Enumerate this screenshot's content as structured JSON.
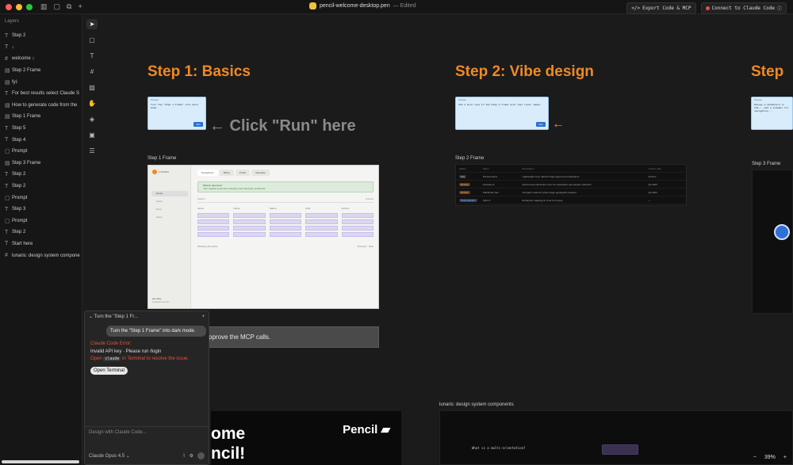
{
  "titlebar": {
    "filename": "pencil-welcome-desktop.pen",
    "status": "— Edited",
    "export_label": "Export Code & MCP",
    "connect_label": "Connect to Claude Code"
  },
  "layers": {
    "title": "Layers",
    "items": [
      {
        "icon": "T",
        "label": "Step 2"
      },
      {
        "icon": "T",
        "label": "↓"
      },
      {
        "icon": "#",
        "label": "welcome ↓"
      },
      {
        "icon": "▤",
        "label": "Step 2 Frame"
      },
      {
        "icon": "▤",
        "label": "fyi:"
      },
      {
        "icon": "T",
        "label": "For best results select Claude S"
      },
      {
        "icon": "▤",
        "label": "How to generate code from the"
      },
      {
        "icon": "▤",
        "label": "Step 1 Frame"
      },
      {
        "icon": "T",
        "label": "Step 5"
      },
      {
        "icon": "T",
        "label": "Step 4"
      },
      {
        "icon": "▢",
        "label": "Prompt"
      },
      {
        "icon": "▤",
        "label": "Step 3 Frame"
      },
      {
        "icon": "T",
        "label": "Step 2"
      },
      {
        "icon": "T",
        "label": "Step 2"
      },
      {
        "icon": "▢",
        "label": "Prompt"
      },
      {
        "icon": "T",
        "label": "Step 3"
      },
      {
        "icon": "▢",
        "label": "Prompt"
      },
      {
        "icon": "T",
        "label": "Step 2"
      },
      {
        "icon": "T",
        "label": "Start here"
      },
      {
        "icon": "#",
        "label": "lunaris: design system compone"
      }
    ]
  },
  "canvas": {
    "step1_heading": "Step 1: Basics",
    "step2_heading": "Step 2: Vibe design",
    "step3_heading": "Step",
    "click_run_hint": "← Click \"Run\" here",
    "step1_frame_label": "Step 1 Frame",
    "step2_frame_label": "Step 2 Frame",
    "step3_frame_label": "Step 3 Frame",
    "approve_text": "pprove the MCP calls.",
    "welcome_text_line1": "ome",
    "welcome_text_line2": "ncil!",
    "pencil_brand": "Pencil",
    "lunaris_label": "lunaris: design system components",
    "lunaris_question": "What is a multi-orientation?",
    "zoom_level": "39%",
    "zoom_minus": "−",
    "zoom_plus": "+"
  },
  "prompt_cards": {
    "label": "Prompt",
    "step1_text": "Turn the \"Step 1 Frame\" into dark mode.",
    "step2_text": "Add a more rows to the Step 2 frame with real rover names.",
    "step3_text": "Design a dashboard in the... add a sidebar for navigation...",
    "run_label": "Run"
  },
  "step1_frame": {
    "brand": "LUNARIS",
    "tabs": [
      "Navigations",
      "Billing",
      "Profile",
      "Metadata"
    ],
    "nav": [
      "Home",
      "Users",
      "Docs",
      "Team"
    ],
    "banner_title": "Mission approved",
    "banner_sub": "Your request to join the Curiosity rover has been confirmed.",
    "search_placeholder": "Search",
    "filter_label": "Archive",
    "columns": [
      "Name",
      "Name",
      "Status",
      "Role",
      "Actions"
    ],
    "footer_left": "Showing 10 results",
    "footer_prev": "Previous",
    "footer_next": "Next",
    "user_name": "Lee Doe",
    "user_email": "lee@lunaris.dev"
  },
  "step2_table": {
    "columns": [
      "Status",
      "Name",
      "Description",
      "Launch date"
    ],
    "rows": [
      {
        "status": "Key",
        "name": "Perseverance",
        "desc": "Lightweight rover ideal for high-speed reconnaissance.",
        "date": "Archive"
      },
      {
        "status": "Review",
        "name": "Curiosity-X",
        "desc": "Autonomous all-terrain rover for exploration and sample collection.",
        "date": "Q4 2025"
      },
      {
        "status": "Review",
        "name": "Pathfinder Neo",
        "desc": "Compact model for short-range geological missions.",
        "date": "Q4 2024"
      },
      {
        "status": "Preproduction",
        "name": "Spirit X",
        "desc": "Enhanced mapping AI rover for survey.",
        "date": "—"
      }
    ]
  },
  "chat": {
    "title": "Turn the \"Step 1 Fr...",
    "user_message": "Turn the \"Step 1 Frame\" into dark mode.",
    "error_title": "Claude Code Error:",
    "error_body": "Invalid API key · Please run /login",
    "error_hint_prefix": "Open",
    "error_hint_code": "claude",
    "error_hint_suffix": "in Terminal to resolve the issue.",
    "open_terminal": "Open Terminal",
    "input_placeholder": "Design with Claude Code...",
    "model_label": "Claude Opus 4.5"
  },
  "colors": {
    "accent_orange": "#f08a24",
    "error_red": "#e5533d",
    "prompt_blue": "#d8ecfb"
  }
}
